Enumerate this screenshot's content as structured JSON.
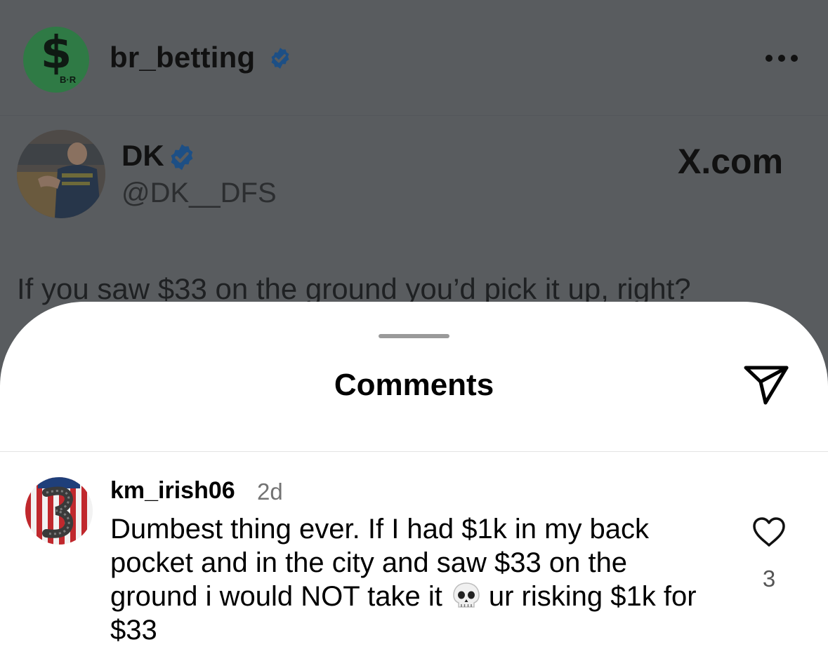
{
  "post": {
    "account_username": "br_betting",
    "avatar_text": "B·R",
    "avatar_symbol": "$",
    "tweet": {
      "author_name": "DK",
      "author_handle": "@DK__DFS",
      "source": "X.com",
      "text": "If you saw $33 on the ground you’d pick it up, right?"
    }
  },
  "comments_sheet": {
    "title": "Comments",
    "comments": [
      {
        "username": "km_irish06",
        "time": "2d",
        "text_before_emoji": "Dumbest thing ever. If I had $1k in my back pocket and in the city and saw $33 on the ground i would NOT take it",
        "emoji": "skull-emoji",
        "text_after_emoji": "ur risking $1k for $33",
        "like_count": "3"
      }
    ]
  },
  "colors": {
    "dim_overlay": "#595c5f",
    "verified_blue": "#1d4f85",
    "sheet_bg": "#ffffff",
    "meta_gray": "#737373"
  },
  "icons": {
    "verified": "verified-badge-icon",
    "more": "more-horizontal-icon",
    "share": "send-share-icon",
    "like": "heart-icon"
  }
}
